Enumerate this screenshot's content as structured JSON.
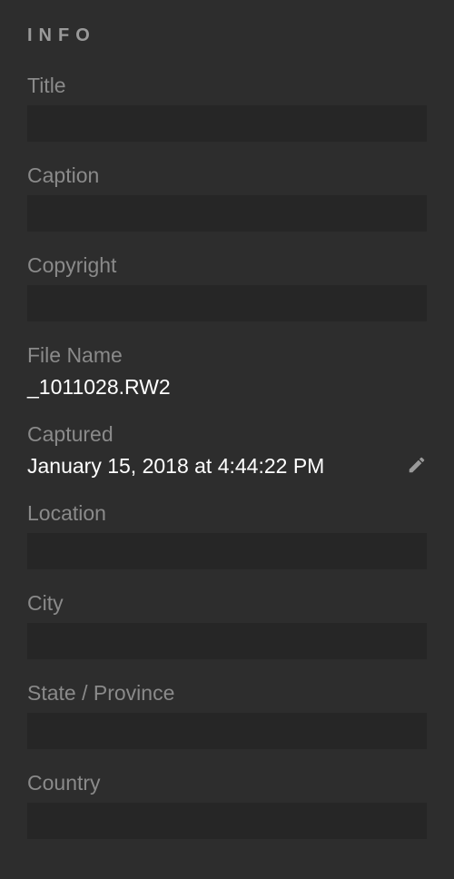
{
  "panel": {
    "header": "INFO",
    "fields": {
      "title": {
        "label": "Title",
        "value": ""
      },
      "caption": {
        "label": "Caption",
        "value": ""
      },
      "copyright": {
        "label": "Copyright",
        "value": ""
      },
      "filename": {
        "label": "File Name",
        "value": "_1011028.RW2"
      },
      "captured": {
        "label": "Captured",
        "value": "January 15, 2018 at 4:44:22 PM"
      },
      "location": {
        "label": "Location",
        "value": ""
      },
      "city": {
        "label": "City",
        "value": ""
      },
      "state": {
        "label": "State / Province",
        "value": ""
      },
      "country": {
        "label": "Country",
        "value": ""
      }
    }
  }
}
